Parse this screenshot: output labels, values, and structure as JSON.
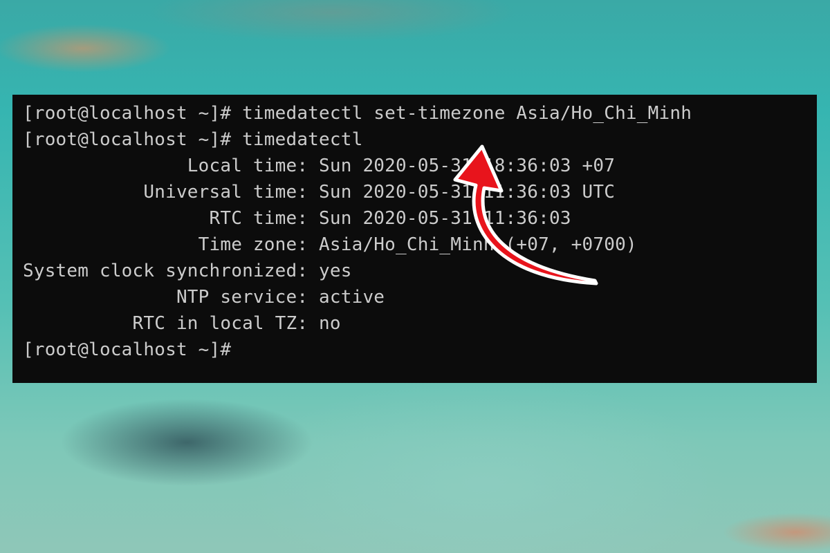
{
  "terminal": {
    "lines": [
      "[root@localhost ~]# timedatectl set-timezone Asia/Ho_Chi_Minh",
      "[root@localhost ~]# timedatectl",
      "               Local time: Sun 2020-05-31 18:36:03 +07",
      "           Universal time: Sun 2020-05-31 11:36:03 UTC",
      "                 RTC time: Sun 2020-05-31 11:36:03",
      "                Time zone: Asia/Ho_Chi_Minh (+07, +0700)",
      "System clock synchronized: yes",
      "              NTP service: active",
      "          RTC in local TZ: no",
      "[root@localhost ~]#"
    ]
  },
  "colors": {
    "terminal_bg": "#0c0c0c",
    "terminal_text": "#cccccc",
    "arrow": "#e8141c"
  },
  "annotation": {
    "icon": "curved-arrow-icon"
  }
}
